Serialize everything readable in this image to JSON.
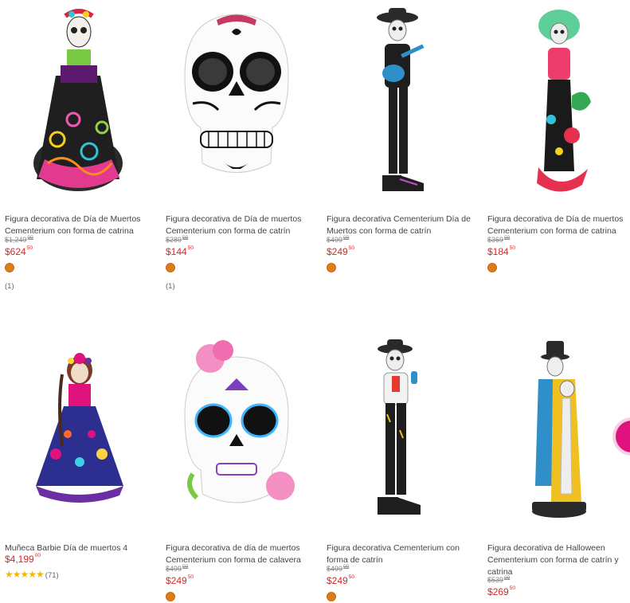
{
  "products": [
    {
      "title": "Figura decorativa de Día de Muertos Cementerium con forma de catrina",
      "old_int": "$1,249",
      "old_cents": "00",
      "price_int": "$624",
      "price_cents": "50",
      "reviews": "(1)",
      "image": "catrina-colorful-dress-figure"
    },
    {
      "title": "Figura decorativa de Día de muertos Cementerium con forma de catrín",
      "old_int": "$289",
      "old_cents": "00",
      "price_int": "$144",
      "price_cents": "50",
      "reviews": "(1)",
      "image": "sugar-skull-black-white"
    },
    {
      "title": "Figura decorativa Cementerium Día de Muertos con forma de catrín",
      "old_int": "$499",
      "old_cents": "00",
      "price_int": "$249",
      "price_cents": "50",
      "reviews": "",
      "image": "mariachi-skeleton-guitar"
    },
    {
      "title": "Figura decorativa de Día de muertos Cementerium con forma de catrina",
      "old_int": "$369",
      "old_cents": "00",
      "price_int": "$184",
      "price_cents": "50",
      "reviews": "",
      "image": "catrina-green-hat-figure"
    },
    {
      "title": "Muñeca Barbie Día de muertos 4",
      "old_int": "",
      "old_cents": "",
      "price_int": "$4,199",
      "price_cents": "00",
      "rating": "★★★★★",
      "rating_count": "(71)",
      "image": "barbie-dia-de-muertos"
    },
    {
      "title": "Figura decorativa de día de muertos Cementerium con forma de calavera",
      "old_int": "$499",
      "old_cents": "00",
      "price_int": "$249",
      "price_cents": "50",
      "reviews": "",
      "image": "sugar-skull-pink-roses"
    },
    {
      "title": "Figura decorativa Cementerium con forma de catrín",
      "old_int": "$499",
      "old_cents": "00",
      "price_int": "$249",
      "price_cents": "50",
      "reviews": "",
      "image": "catrin-skeleton-maracas"
    },
    {
      "title": "Figura decorativa de Halloween Cementerium con forma de catrín y catrina",
      "old_int": "$539",
      "old_cents": "00",
      "price_int": "$269",
      "price_cents": "50",
      "reviews": "",
      "image": "catrin-catrina-couple"
    }
  ],
  "colors": {
    "price": "#d12a2a",
    "swatch": "#e07b1a",
    "side_tab": "#e0127e"
  }
}
